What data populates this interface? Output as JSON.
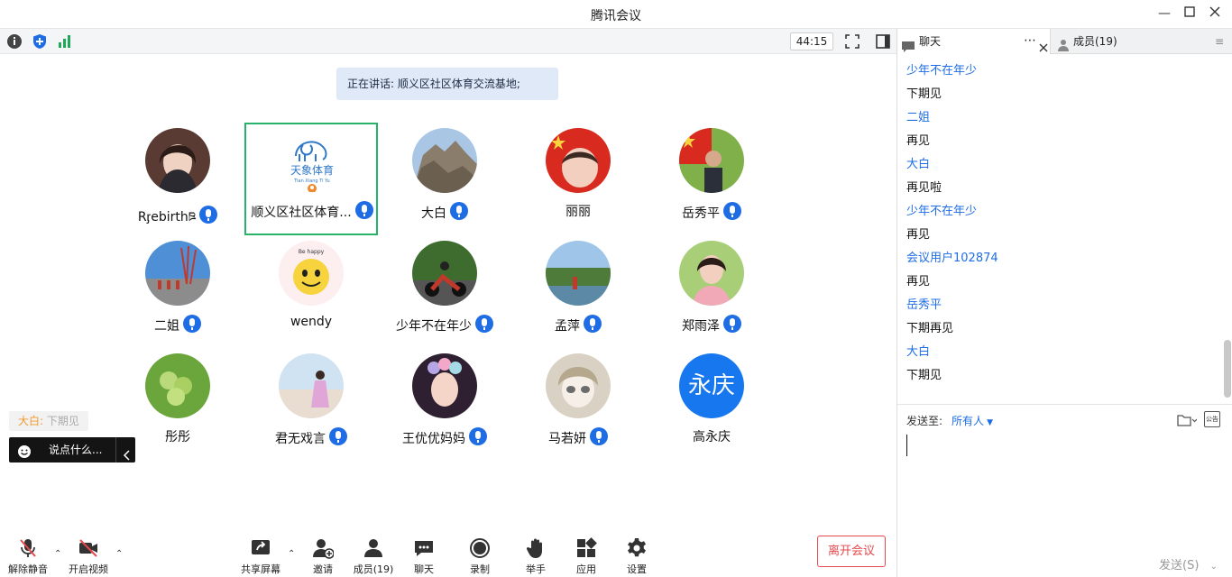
{
  "window": {
    "title": "腾讯会议"
  },
  "toolbar": {
    "timer": "44:15"
  },
  "stage": {
    "speaking": "正在讲话: 顺义区社区体育交流基地;",
    "participants": [
      {
        "name": "Rᶉebirthཋ",
        "muted": false
      },
      {
        "name": "顺义区社区体育...",
        "muted": false,
        "logo_text": "天象体育",
        "logo_sub": "Tian Xiang Ti Yu"
      },
      {
        "name": "大白",
        "muted": false
      },
      {
        "name": "丽丽",
        "muted": true
      },
      {
        "name": "岳秀平",
        "muted": false
      },
      {
        "name": "二姐",
        "muted": false
      },
      {
        "name": "wendy",
        "muted": true,
        "badge": "Be happy"
      },
      {
        "name": "少年不在年少",
        "muted": false
      },
      {
        "name": "孟萍",
        "muted": false
      },
      {
        "name": "郑雨泽",
        "muted": false
      },
      {
        "name": "彤彤",
        "muted": true
      },
      {
        "name": "君无戏言",
        "muted": false
      },
      {
        "name": "王优优妈妈",
        "muted": false
      },
      {
        "name": "马若妍",
        "muted": false
      },
      {
        "name": "高永庆",
        "muted": true,
        "initials": "永庆"
      }
    ],
    "toast": {
      "sender": "大白:",
      "message": "下期见"
    },
    "say_placeholder": "说点什么..."
  },
  "bottom": {
    "unmute": "解除静音",
    "start_video": "开启视频",
    "share_screen": "共享屏幕",
    "invite": "邀请",
    "members": "成员(19)",
    "chat": "聊天",
    "record": "录制",
    "raise_hand": "举手",
    "apps": "应用",
    "settings": "设置",
    "leave": "离开会议"
  },
  "side": {
    "tab_chat": "聊天",
    "tab_members": "成员(19)",
    "messages": [
      {
        "kind": "sender",
        "text": "少年不在年少"
      },
      {
        "kind": "text",
        "text": "下期见"
      },
      {
        "kind": "sender",
        "text": "二姐"
      },
      {
        "kind": "text",
        "text": "再见"
      },
      {
        "kind": "sender",
        "text": "大白"
      },
      {
        "kind": "text",
        "text": "再见啦"
      },
      {
        "kind": "sender",
        "text": "少年不在年少"
      },
      {
        "kind": "text",
        "text": "再见"
      },
      {
        "kind": "sender",
        "text": "会议用户102874"
      },
      {
        "kind": "text",
        "text": "再见"
      },
      {
        "kind": "sender",
        "text": "岳秀平"
      },
      {
        "kind": "text",
        "text": "下期再见"
      },
      {
        "kind": "sender",
        "text": "大白"
      },
      {
        "kind": "text",
        "text": "下期见"
      }
    ],
    "send_to_label": "发送至:",
    "send_to_target": "所有人",
    "send_button": "发送(S)",
    "notice_label": "公告"
  },
  "colors": {
    "accent": "#1e6de5",
    "active_border": "#27b46a",
    "leave": "#e5484d"
  }
}
